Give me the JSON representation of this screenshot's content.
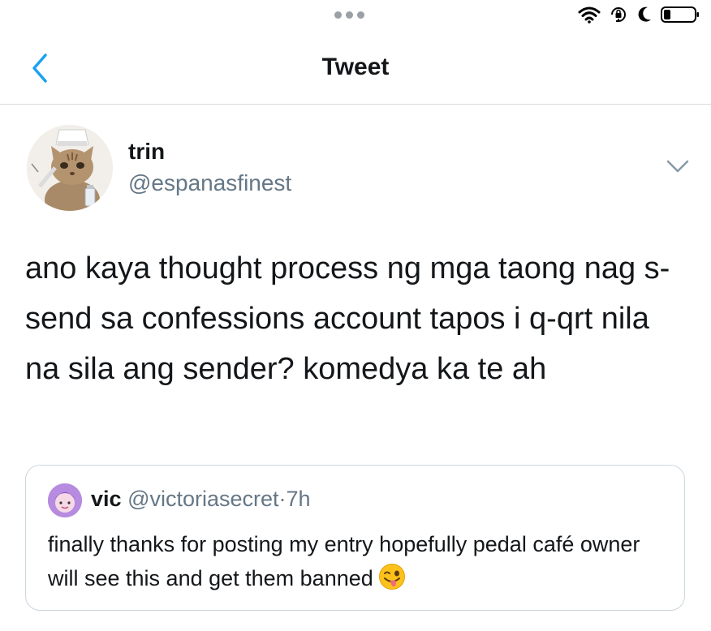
{
  "nav": {
    "title": "Tweet"
  },
  "status_bar": {
    "icons": [
      "more-dots-icon",
      "wifi-icon",
      "rotation-lock-icon",
      "moon-icon",
      "battery-icon"
    ]
  },
  "tweet": {
    "author": {
      "display_name": "trin",
      "handle": "@espanasfinest"
    },
    "text": "ano kaya thought process ng mga taong nag s-send sa confessions account tapos i q-qrt nila na sila ang sender? komedya ka te ah"
  },
  "quoted_tweet": {
    "display_name": "vic",
    "handle": "@victoriasecret",
    "separator": "·",
    "time": "7h",
    "text": "finally thanks for posting my entry hopefully pedal café owner will see this and get them banned",
    "emoji": "winking-face-with-tongue"
  },
  "colors": {
    "accent": "#1da1f2",
    "text": "#14171a",
    "secondary_text": "#657786",
    "border": "#ccd6dd"
  }
}
